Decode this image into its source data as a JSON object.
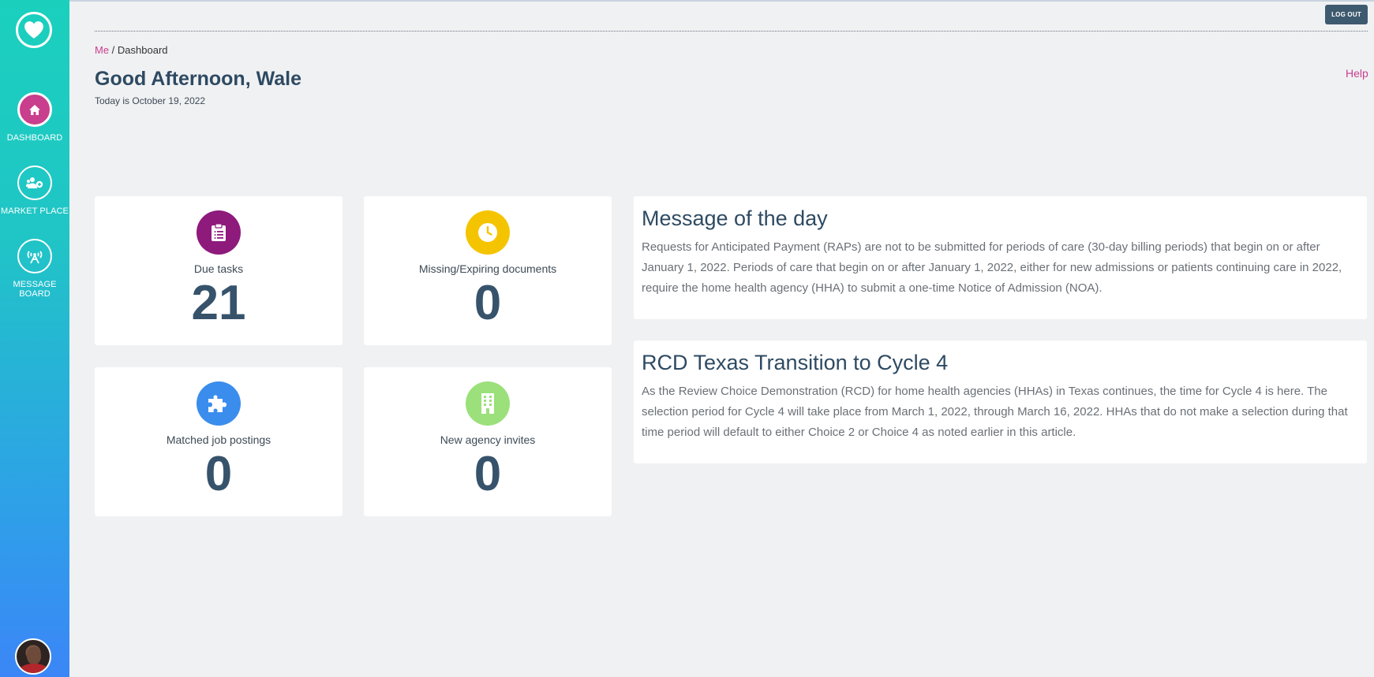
{
  "sidebar": {
    "logo_icon": "heart-icon",
    "items": [
      {
        "label": "DASHBOARD",
        "icon": "home-icon",
        "active": true
      },
      {
        "label": "MARKET PLACE",
        "icon": "users-add-icon",
        "active": false
      },
      {
        "label": "MESSAGE BOARD",
        "icon": "broadcast-icon",
        "active": false
      }
    ],
    "avatar": "user-avatar"
  },
  "header": {
    "logout_label": "LOG OUT",
    "breadcrumb": {
      "link": "Me",
      "separator": " / ",
      "current": "Dashboard"
    },
    "greeting": "Good Afternoon, Wale",
    "date_text": "Today is October 19, 2022",
    "help_label": "Help"
  },
  "stats": [
    {
      "label": "Due tasks",
      "value": "21",
      "icon": "clipboard-icon",
      "color": "#8e1a7c"
    },
    {
      "label": "Missing/Expiring documents",
      "value": "0",
      "icon": "clock-icon",
      "color": "#f5c400"
    },
    {
      "label": "Matched job postings",
      "value": "0",
      "icon": "puzzle-icon",
      "color": "#3b8ded"
    },
    {
      "label": "New agency invites",
      "value": "0",
      "icon": "building-icon",
      "color": "#9be07a"
    }
  ],
  "messages": [
    {
      "title": "Message of the day",
      "body": "Requests for Anticipated Payment (RAPs) are not to be submitted for periods of care (30-day billing periods) that begin on or after January 1, 2022. Periods of care that begin on or after January 1, 2022, either for new admissions or patients continuing care in 2022, require the home health agency (HHA) to submit a one-time Notice of Admission (NOA)."
    },
    {
      "title": "RCD Texas Transition to Cycle 4",
      "body": "As the Review Choice Demonstration (RCD) for home health agencies (HHAs) in Texas continues, the time for Cycle 4 is here. The selection period for Cycle 4 will take place from March 1, 2022, through March 16, 2022. HHAs that do not make a selection during that time period will default to either Choice 2 or Choice 4 as noted earlier in this article."
    }
  ],
  "colors": {
    "accent": "#c93e8d",
    "title": "#2e4a62",
    "logout_bg": "#3e5a6f"
  }
}
